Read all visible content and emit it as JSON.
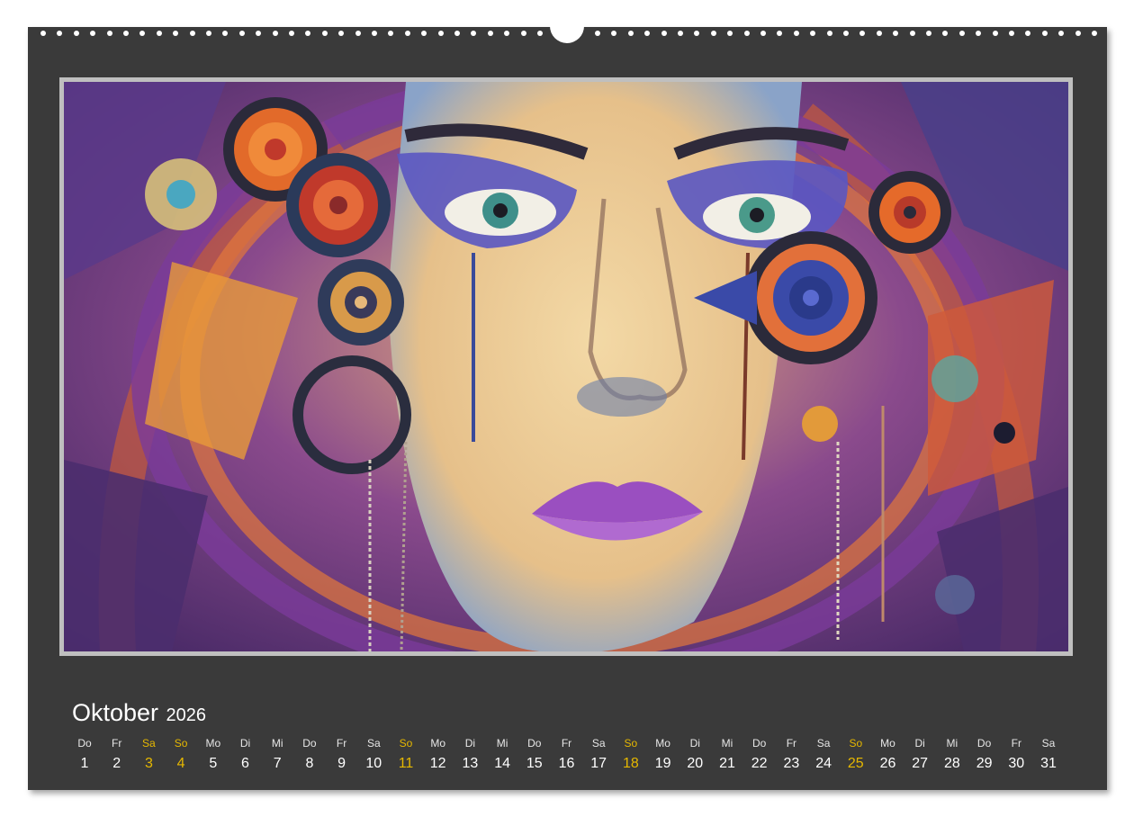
{
  "month": {
    "name": "Oktober",
    "year": "2026"
  },
  "colors": {
    "frame": "#3a3a3a",
    "text": "#ffffff",
    "weekend": "#e6b800"
  },
  "days": [
    {
      "dow": "Do",
      "num": "1",
      "weekend": false
    },
    {
      "dow": "Fr",
      "num": "2",
      "weekend": false
    },
    {
      "dow": "Sa",
      "num": "3",
      "weekend": true
    },
    {
      "dow": "So",
      "num": "4",
      "weekend": true
    },
    {
      "dow": "Mo",
      "num": "5",
      "weekend": false
    },
    {
      "dow": "Di",
      "num": "6",
      "weekend": false
    },
    {
      "dow": "Mi",
      "num": "7",
      "weekend": false
    },
    {
      "dow": "Do",
      "num": "8",
      "weekend": false
    },
    {
      "dow": "Fr",
      "num": "9",
      "weekend": false
    },
    {
      "dow": "Sa",
      "num": "10",
      "weekend": false
    },
    {
      "dow": "So",
      "num": "11",
      "weekend": true
    },
    {
      "dow": "Mo",
      "num": "12",
      "weekend": false
    },
    {
      "dow": "Di",
      "num": "13",
      "weekend": false
    },
    {
      "dow": "Mi",
      "num": "14",
      "weekend": false
    },
    {
      "dow": "Do",
      "num": "15",
      "weekend": false
    },
    {
      "dow": "Fr",
      "num": "16",
      "weekend": false
    },
    {
      "dow": "Sa",
      "num": "17",
      "weekend": false
    },
    {
      "dow": "So",
      "num": "18",
      "weekend": true
    },
    {
      "dow": "Mo",
      "num": "19",
      "weekend": false
    },
    {
      "dow": "Di",
      "num": "20",
      "weekend": false
    },
    {
      "dow": "Mi",
      "num": "21",
      "weekend": false
    },
    {
      "dow": "Do",
      "num": "22",
      "weekend": false
    },
    {
      "dow": "Fr",
      "num": "23",
      "weekend": false
    },
    {
      "dow": "Sa",
      "num": "24",
      "weekend": false
    },
    {
      "dow": "So",
      "num": "25",
      "weekend": true
    },
    {
      "dow": "Mo",
      "num": "26",
      "weekend": false
    },
    {
      "dow": "Di",
      "num": "27",
      "weekend": false
    },
    {
      "dow": "Mi",
      "num": "28",
      "weekend": false
    },
    {
      "dow": "Do",
      "num": "29",
      "weekend": false
    },
    {
      "dow": "Fr",
      "num": "30",
      "weekend": false
    },
    {
      "dow": "Sa",
      "num": "31",
      "weekend": false
    }
  ]
}
